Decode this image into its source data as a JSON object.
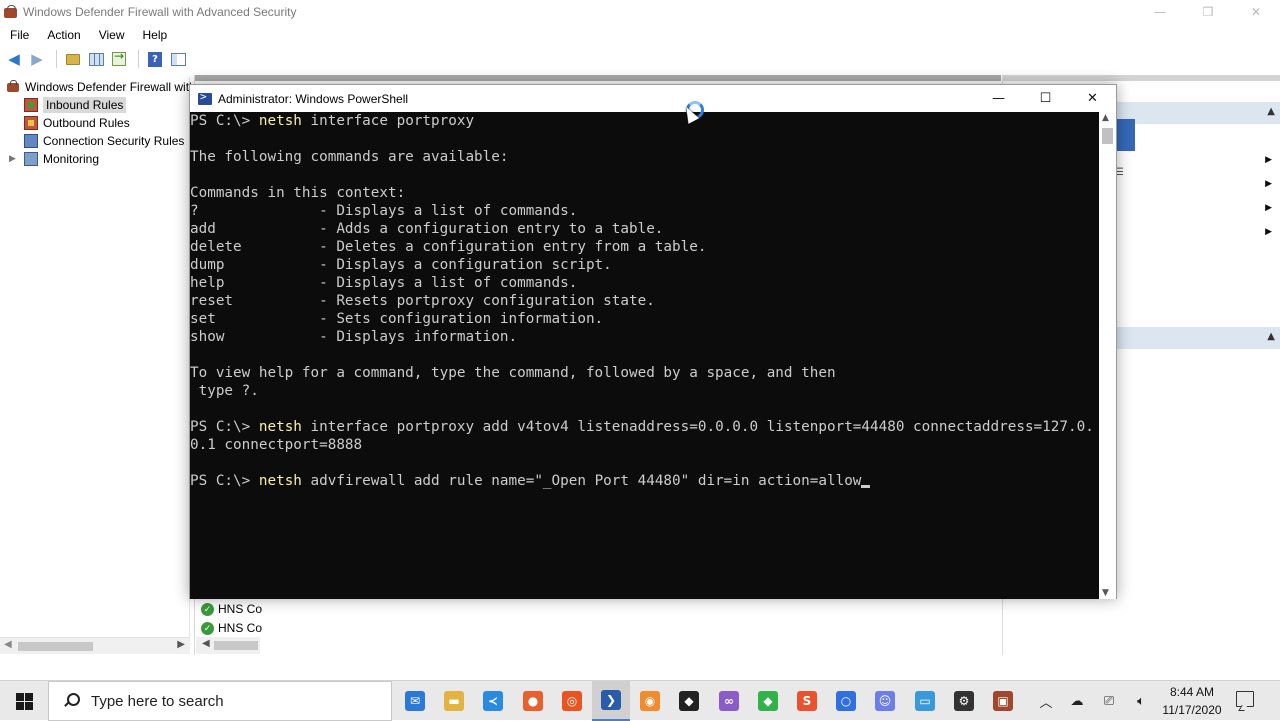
{
  "mmc": {
    "title": "Windows Defender Firewall with Advanced Security",
    "menu": [
      "File",
      "Action",
      "View",
      "Help"
    ],
    "toolbar_icons": [
      "back-arrow-icon",
      "forward-arrow-icon",
      "up-folder-icon",
      "show-hide-tree-icon",
      "export-list-icon",
      "help-icon",
      "action-pane-icon"
    ],
    "tree": {
      "root": "Windows Defender Firewall with",
      "items": [
        "Inbound Rules",
        "Outbound Rules",
        "Connection Security Rules",
        "Monitoring"
      ],
      "selected": "Inbound Rules"
    },
    "list_rows": [
      "HNS Co",
      "HNS Co"
    ]
  },
  "powershell": {
    "title": "Administrator: Windows PowerShell",
    "lines": [
      {
        "prompt": "PS C:\\> ",
        "cmd": "netsh",
        "rest": " interface portproxy"
      },
      {
        "text": ""
      },
      {
        "text": "The following commands are available:"
      },
      {
        "text": ""
      },
      {
        "text": "Commands in this context:"
      },
      {
        "text": "?              - Displays a list of commands."
      },
      {
        "text": "add            - Adds a configuration entry to a table."
      },
      {
        "text": "delete         - Deletes a configuration entry from a table."
      },
      {
        "text": "dump           - Displays a configuration script."
      },
      {
        "text": "help           - Displays a list of commands."
      },
      {
        "text": "reset          - Resets portproxy configuration state."
      },
      {
        "text": "set            - Sets configuration information."
      },
      {
        "text": "show           - Displays information."
      },
      {
        "text": ""
      },
      {
        "text": "To view help for a command, type the command, followed by a space, and then"
      },
      {
        "text": " type ?."
      },
      {
        "text": ""
      },
      {
        "prompt": "PS C:\\> ",
        "cmd": "netsh",
        "rest": " interface portproxy add v4tov4 listenaddress=0.0.0.0 listenport=44480 connectaddress=127.0."
      },
      {
        "text": "0.1 connectport=8888"
      },
      {
        "text": ""
      },
      {
        "prompt": "PS C:\\> ",
        "cmd": "netsh",
        "rest": " advfirewall add rule name=\"_Open Port 44480\" dir=in action=allow"
      }
    ]
  },
  "taskbar": {
    "search_placeholder": "Type here to search",
    "apps": [
      {
        "name": "mail",
        "glyph": "✉",
        "color": "#2b79d6"
      },
      {
        "name": "file-explorer",
        "glyph": "▬",
        "color": "#e3b341"
      },
      {
        "name": "vscode",
        "glyph": "≺",
        "color": "#2a8ae0"
      },
      {
        "name": "firefox",
        "glyph": "●",
        "color": "#e8602c"
      },
      {
        "name": "ubuntu",
        "glyph": "◎",
        "color": "#e95420"
      },
      {
        "name": "powershell",
        "glyph": "❯",
        "color": "#2a5caa",
        "active": true
      },
      {
        "name": "origin",
        "glyph": "◉",
        "color": "#f28a2e"
      },
      {
        "name": "unity",
        "glyph": "◆",
        "color": "#222222"
      },
      {
        "name": "visual-studio",
        "glyph": "∞",
        "color": "#8b5cc8"
      },
      {
        "name": "git",
        "glyph": "◆",
        "color": "#2fb34a"
      },
      {
        "name": "sublime",
        "glyph": "S",
        "color": "#e8532e"
      },
      {
        "name": "signal",
        "glyph": "○",
        "color": "#2f6fe0"
      },
      {
        "name": "discord",
        "glyph": "☺",
        "color": "#6c7ee8"
      },
      {
        "name": "remote-desktop",
        "glyph": "▭",
        "color": "#3a9ad9"
      },
      {
        "name": "settings",
        "glyph": "⚙",
        "color": "#333333"
      },
      {
        "name": "firewall",
        "glyph": "▣",
        "color": "#a0472e"
      }
    ],
    "tray_icons": [
      "chevron-up-icon",
      "cloud-icon",
      "network-icon",
      "volume-icon"
    ],
    "time": "8:44 AM",
    "date": "11/17/2020"
  }
}
